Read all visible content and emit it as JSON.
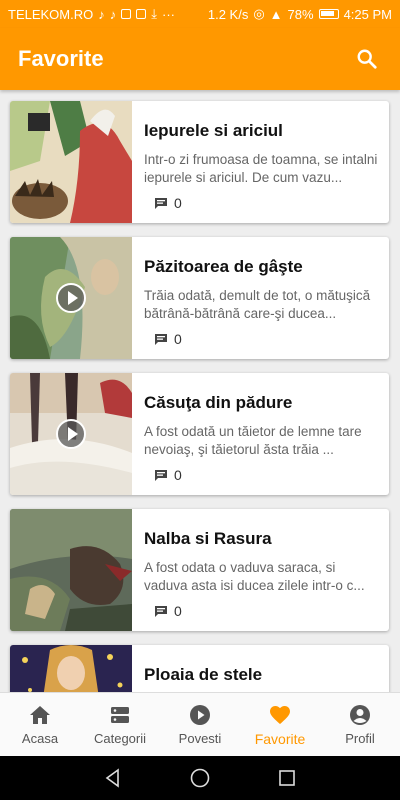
{
  "status_bar": {
    "carrier": "TELEKOM.RO",
    "speed": "1.2 K/s",
    "battery": "78%",
    "time": "4:25 PM"
  },
  "header": {
    "title": "Favorite",
    "search_icon": "search-icon"
  },
  "stories": [
    {
      "title": "Iepurele si ariciul",
      "excerpt": "Intr-o zi frumoasa de toamna, se intalni iepurele si ariciul. De cum vazu...",
      "comments": "0",
      "has_video": false
    },
    {
      "title": "Păzitoarea de gâşte",
      "excerpt": "Trăia odată, demult de tot, o mătuşică bătrână-bătrână care-şi ducea...",
      "comments": "0",
      "has_video": true
    },
    {
      "title": "Căsuţa din pădure",
      "excerpt": "A fost odată un tăietor de lemne tare nevoiaş, şi tăietorul ăsta trăia ...",
      "comments": "0",
      "has_video": true
    },
    {
      "title": "Nalba si Rasura",
      "excerpt": "A fost odata o vaduva saraca, si vaduva asta isi ducea zilele intr-o c...",
      "comments": "0",
      "has_video": false
    },
    {
      "title": "Ploaia de stele",
      "excerpt": "",
      "comments": "",
      "has_video": false
    }
  ],
  "bottom_nav": [
    {
      "label": "Acasa",
      "icon": "home-icon",
      "active": false
    },
    {
      "label": "Categorii",
      "icon": "categories-icon",
      "active": false
    },
    {
      "label": "Povesti",
      "icon": "play-circle-icon",
      "active": false
    },
    {
      "label": "Favorite",
      "icon": "heart-icon",
      "active": true
    },
    {
      "label": "Profil",
      "icon": "account-icon",
      "active": false
    }
  ],
  "colors": {
    "accent": "#ff9800",
    "inactive": "#555555"
  }
}
